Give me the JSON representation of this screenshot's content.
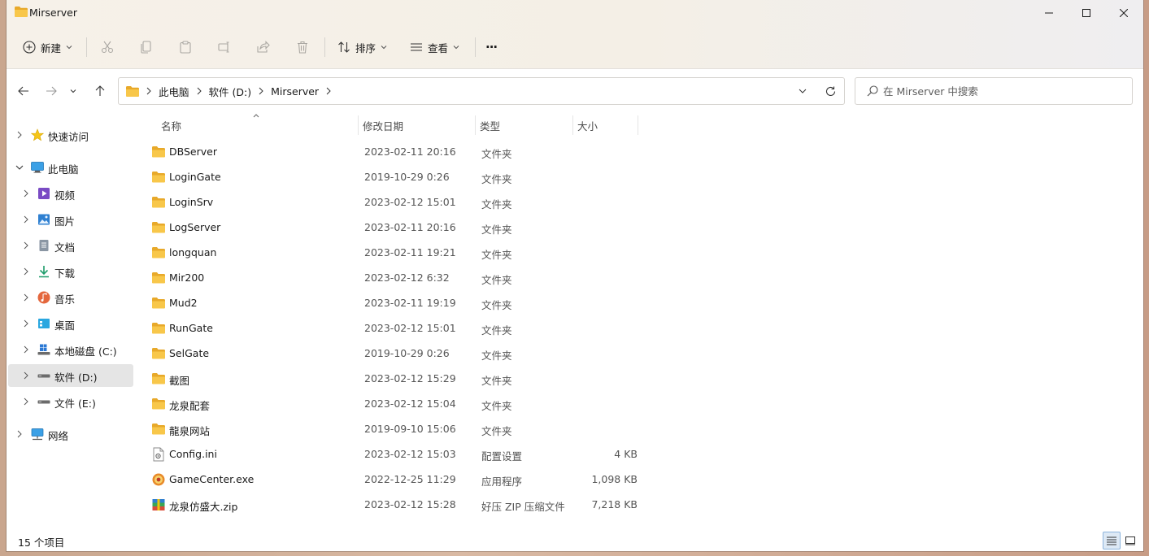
{
  "window": {
    "title": "Mirserver"
  },
  "toolbar": {
    "new_label": "新建",
    "sort_label": "排序",
    "view_label": "查看",
    "more_label": "···"
  },
  "address": {
    "crumbs": [
      "此电脑",
      "软件 (D:)",
      "Mirserver"
    ]
  },
  "search": {
    "placeholder": "在 Mirserver 中搜索"
  },
  "sidebar": {
    "items": [
      {
        "label": "快速访问",
        "icon": "star-icon"
      },
      {
        "label": "此电脑",
        "icon": "computer-icon"
      },
      {
        "label": "视频",
        "icon": "video-icon"
      },
      {
        "label": "图片",
        "icon": "picture-icon"
      },
      {
        "label": "文档",
        "icon": "document-icon"
      },
      {
        "label": "下载",
        "icon": "download-icon"
      },
      {
        "label": "音乐",
        "icon": "music-icon"
      },
      {
        "label": "桌面",
        "icon": "desktop-icon"
      },
      {
        "label": "本地磁盘 (C:)",
        "icon": "windows-drive-icon"
      },
      {
        "label": "软件 (D:)",
        "icon": "drive-icon"
      },
      {
        "label": "文件 (E:)",
        "icon": "drive-icon"
      },
      {
        "label": "网络",
        "icon": "network-icon"
      }
    ]
  },
  "columns": {
    "name": "名称",
    "date": "修改日期",
    "type": "类型",
    "size": "大小"
  },
  "files": [
    {
      "name": "DBServer",
      "date": "2023-02-11 20:16",
      "type": "文件夹",
      "size": "",
      "icon": "folder-icon"
    },
    {
      "name": "LoginGate",
      "date": "2019-10-29 0:26",
      "type": "文件夹",
      "size": "",
      "icon": "folder-icon"
    },
    {
      "name": "LoginSrv",
      "date": "2023-02-12 15:01",
      "type": "文件夹",
      "size": "",
      "icon": "folder-icon"
    },
    {
      "name": "LogServer",
      "date": "2023-02-11 20:16",
      "type": "文件夹",
      "size": "",
      "icon": "folder-icon"
    },
    {
      "name": "longquan",
      "date": "2023-02-11 19:21",
      "type": "文件夹",
      "size": "",
      "icon": "folder-icon"
    },
    {
      "name": "Mir200",
      "date": "2023-02-12 6:32",
      "type": "文件夹",
      "size": "",
      "icon": "folder-icon"
    },
    {
      "name": "Mud2",
      "date": "2023-02-11 19:19",
      "type": "文件夹",
      "size": "",
      "icon": "folder-icon"
    },
    {
      "name": "RunGate",
      "date": "2023-02-12 15:01",
      "type": "文件夹",
      "size": "",
      "icon": "folder-icon"
    },
    {
      "name": "SelGate",
      "date": "2019-10-29 0:26",
      "type": "文件夹",
      "size": "",
      "icon": "folder-icon"
    },
    {
      "name": "截图",
      "date": "2023-02-12 15:29",
      "type": "文件夹",
      "size": "",
      "icon": "folder-icon"
    },
    {
      "name": "龙泉配套",
      "date": "2023-02-12 15:04",
      "type": "文件夹",
      "size": "",
      "icon": "folder-icon"
    },
    {
      "name": "龍泉网站",
      "date": "2019-09-10 15:06",
      "type": "文件夹",
      "size": "",
      "icon": "folder-icon"
    },
    {
      "name": "Config.ini",
      "date": "2023-02-12 15:03",
      "type": "配置设置",
      "size": "4 KB",
      "icon": "ini-file-icon"
    },
    {
      "name": "GameCenter.exe",
      "date": "2022-12-25 11:29",
      "type": "应用程序",
      "size": "1,098 KB",
      "icon": "exe-file-icon"
    },
    {
      "name": "龙泉仿盛大.zip",
      "date": "2023-02-12 15:28",
      "type": "好压 ZIP 压缩文件",
      "size": "7,218 KB",
      "icon": "zip-file-icon"
    }
  ],
  "status": {
    "item_count": "15 个项目"
  },
  "colors": {
    "folder": "#f8c74a",
    "folder_dark": "#e8a92a",
    "selection": "#e5e5e5",
    "accent": "#2b78d4"
  }
}
